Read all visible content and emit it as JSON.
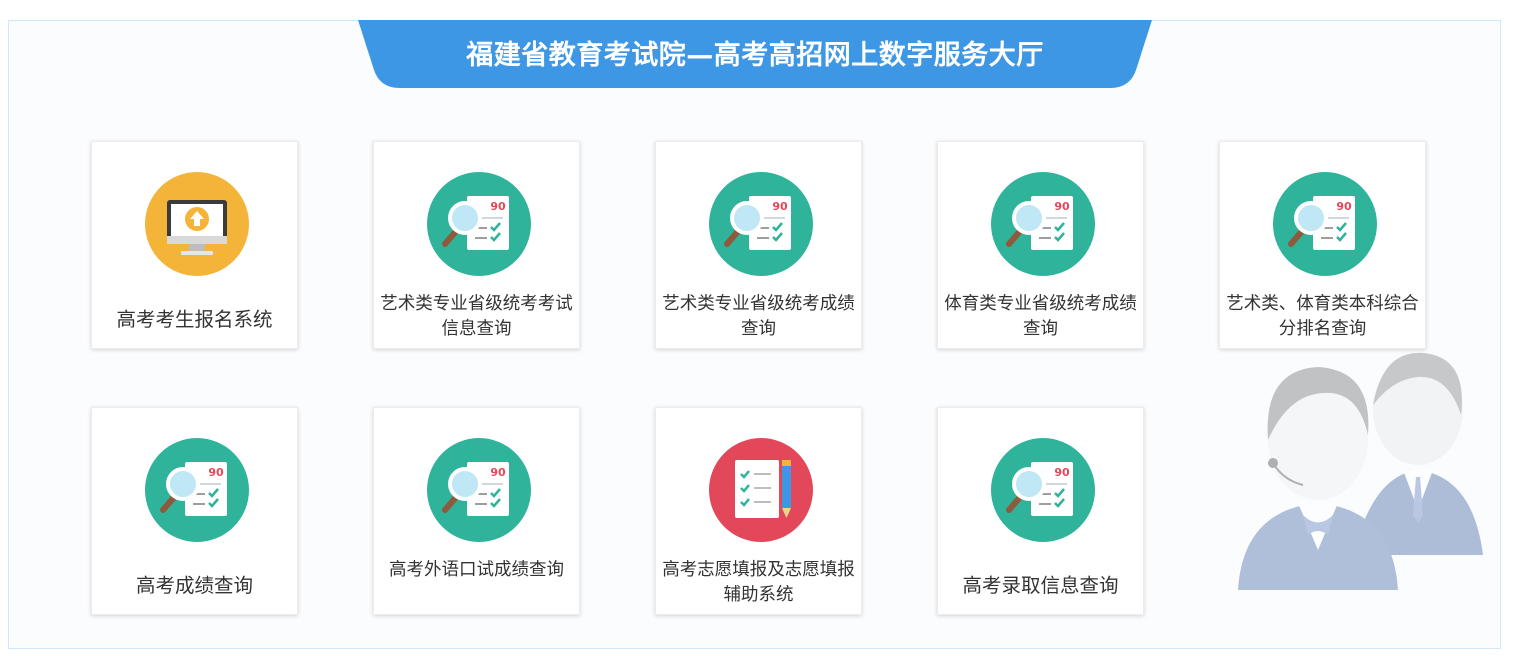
{
  "banner": {
    "title": "福建省教育考试院—高考高招网上数字服务大厅"
  },
  "colors": {
    "banner_blue": "#3d97e4",
    "teal": "#2fb39a",
    "orange": "#f4b43a",
    "red": "#e2485a",
    "panel_border": "#d3e8f6"
  },
  "services": [
    {
      "label": "高考考生报名系统",
      "icon": "computer-upload-icon"
    },
    {
      "label": "艺术类专业省级统考考试信息查询",
      "icon": "score-sheet-magnifier-icon"
    },
    {
      "label": "艺术类专业省级统考成绩查询",
      "icon": "score-sheet-magnifier-icon"
    },
    {
      "label": "体育类专业省级统考成绩查询",
      "icon": "score-sheet-magnifier-icon"
    },
    {
      "label": "艺术类、体育类本科综合分排名查询",
      "icon": "score-sheet-magnifier-icon"
    },
    {
      "label": "高考成绩查询",
      "icon": "score-sheet-magnifier-icon"
    },
    {
      "label": "高考外语口试成绩查询",
      "icon": "score-sheet-magnifier-icon"
    },
    {
      "label": "高考志愿填报及志愿填报辅助系统",
      "icon": "checklist-pencil-icon"
    },
    {
      "label": "高考录取信息查询",
      "icon": "score-sheet-magnifier-icon"
    }
  ],
  "score_mark": "90"
}
